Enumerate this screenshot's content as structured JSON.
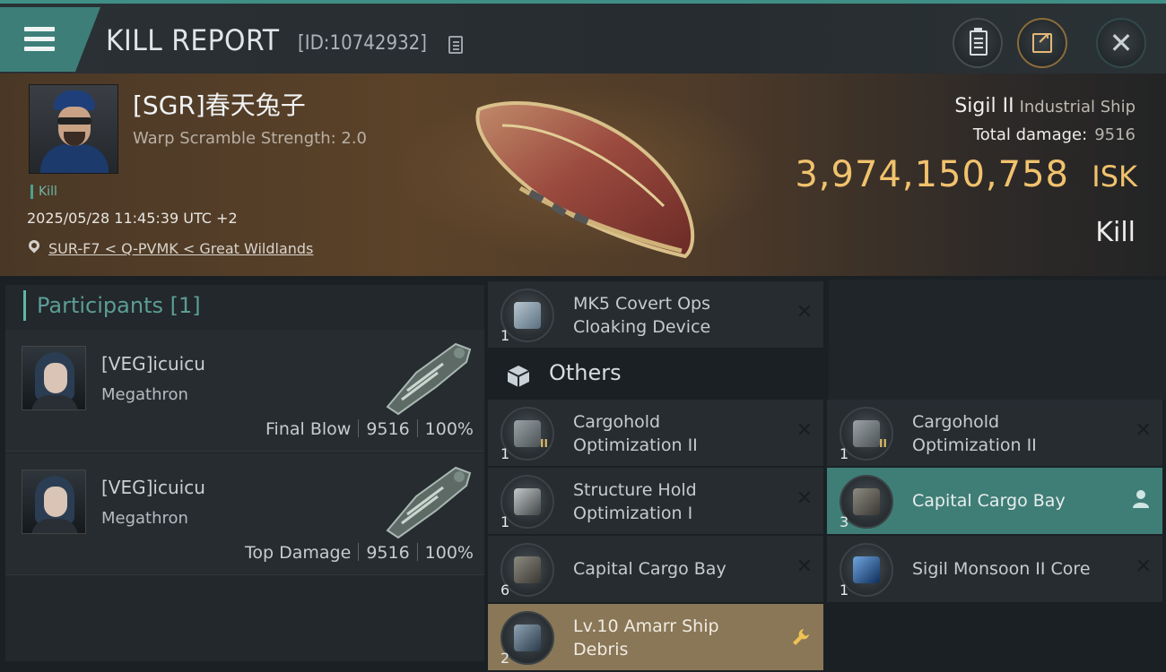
{
  "header": {
    "title": "KILL REPORT",
    "report_id": "[ID:10742932]"
  },
  "victim": {
    "name": "[SGR]春天兔子",
    "warp_scramble": "Warp Scramble Strength: 2.0",
    "tag": "Kill",
    "datetime": "2025/05/28 11:45:39 UTC +2",
    "location": "SUR-F7 < Q-PVMK < Great Wildlands"
  },
  "ship": {
    "name": "Sigil II",
    "class": "Industrial Ship",
    "total_damage_label": "Total damage:",
    "total_damage": "9516",
    "isk_value": "3,974,150,758",
    "isk_unit": "ISK",
    "result": "Kill"
  },
  "participants": {
    "header": "Participants [1]",
    "list": [
      {
        "name": "[VEG]icuicu",
        "ship": "Megathron",
        "role": "Final Blow",
        "damage": "9516",
        "percent": "100%"
      },
      {
        "name": "[VEG]icuicu",
        "ship": "Megathron",
        "role": "Top Damage",
        "damage": "9516",
        "percent": "100%"
      }
    ]
  },
  "items": {
    "others_label": "Others",
    "top": {
      "qty": "1",
      "line1": "MK5 Covert Ops",
      "line2": "Cloaking Device",
      "action": "x"
    },
    "grid": [
      {
        "qty": "1",
        "tier": "II",
        "line1": "Cargohold",
        "line2": "Optimization II",
        "action": "x"
      },
      {
        "qty": "1",
        "tier": "II",
        "line1": "Cargohold",
        "line2": "Optimization II",
        "action": "x"
      },
      {
        "qty": "1",
        "tier": "",
        "line1": "Structure Hold",
        "line2": "Optimization I",
        "action": "x"
      },
      {
        "qty": "3",
        "tier": "",
        "line1": "Capital Cargo Bay",
        "line2": "",
        "action": "person"
      },
      {
        "qty": "6",
        "tier": "",
        "line1": "Capital Cargo Bay",
        "line2": "",
        "action": "x"
      },
      {
        "qty": "1",
        "tier": "",
        "line1": "Sigil Monsoon II Core",
        "line2": "",
        "action": "x"
      },
      {
        "qty": "2",
        "tier": "",
        "line1": "Lv.10 Amarr Ship",
        "line2": "Debris",
        "action": "wrench"
      }
    ]
  },
  "colors": {
    "accent_teal": "#3f7e77",
    "isk_gold": "#f1c26d",
    "debris_tan": "#8a7757"
  }
}
